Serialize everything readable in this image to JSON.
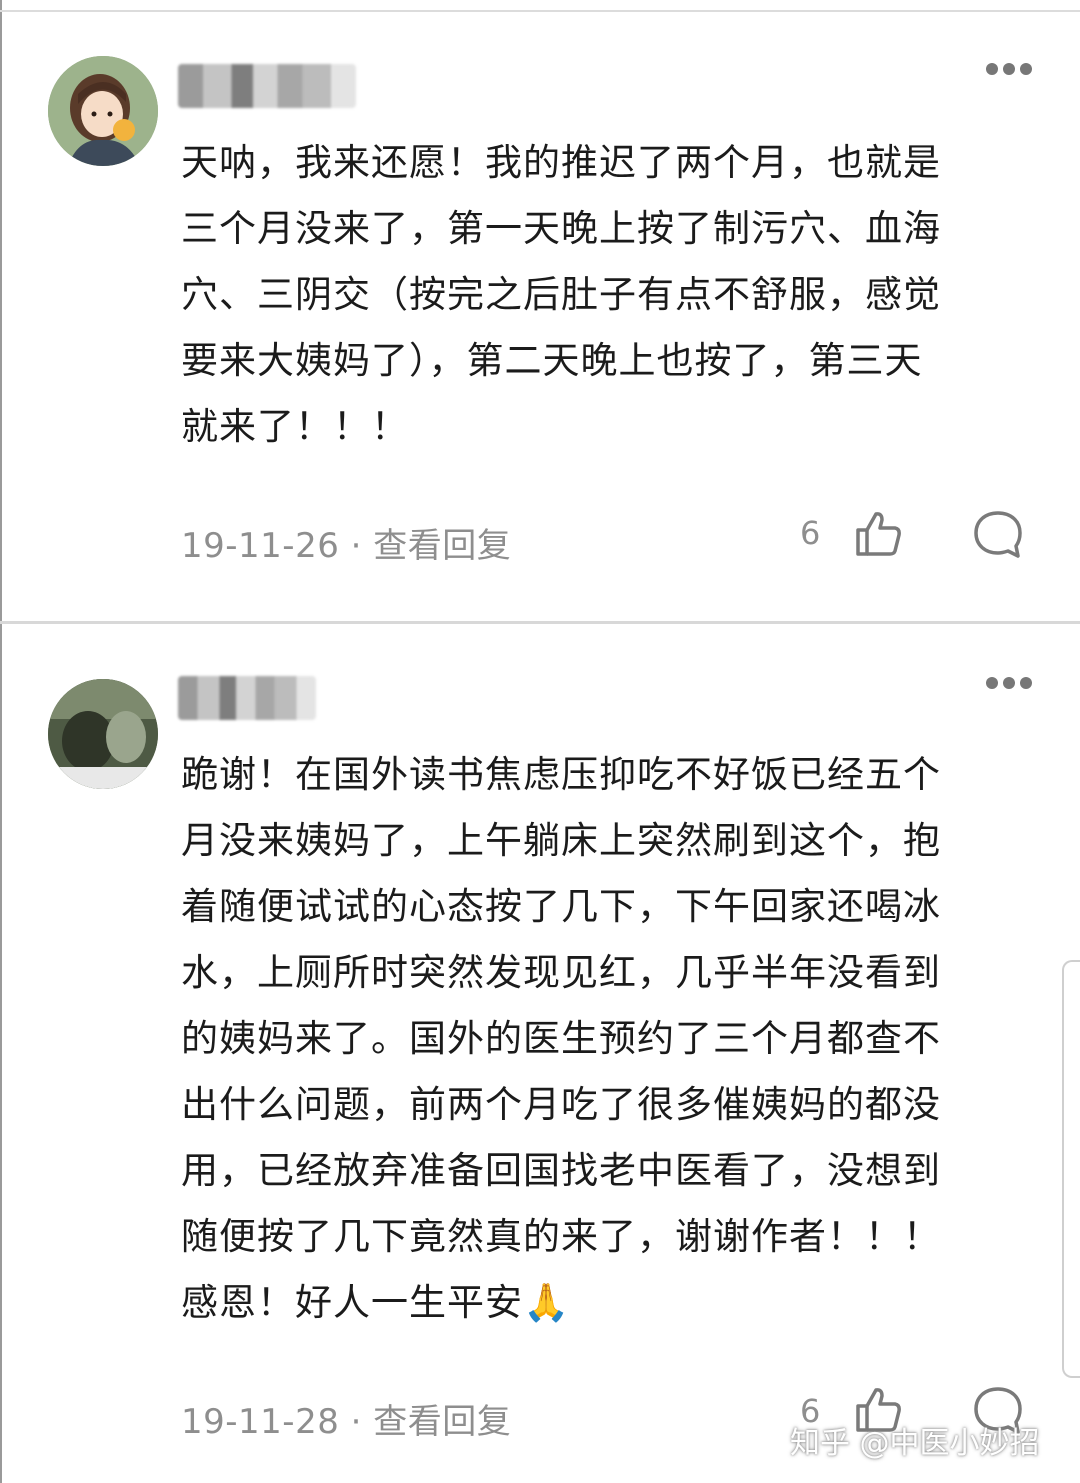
{
  "comments": [
    {
      "text": "天呐，我来还愿！我的推迟了两个月，也就是\n三个月没来了，第一天晚上按了制污穴、血海\n穴、三阴交（按完之后肚子有点不舒服，感觉\n要来大姨妈了），第二天晚上也按了，第三天\n就来了！！！",
      "meta": "19-11-26 · 查看回复",
      "like_count": "6"
    },
    {
      "text": "跪谢！在国外读书焦虑压抑吃不好饭已经五个\n月没来姨妈了，上午躺床上突然刷到这个，抱\n着随便试试的心态按了几下，下午回家还喝冰\n水，上厕所时突然发现见红，几乎半年没看到\n的姨妈来了。国外的医生预约了三个月都查不\n出什么问题，前两个月吃了很多催姨妈的都没\n用，已经放弃准备回国找老中医看了，没想到\n随便按了几下竟然真的来了，谢谢作者！！！\n感恩！好人一生平安🙏",
      "meta": "19-11-28 · 查看回复",
      "like_count": "6"
    }
  ],
  "watermark": "知乎 @中医小妙招"
}
